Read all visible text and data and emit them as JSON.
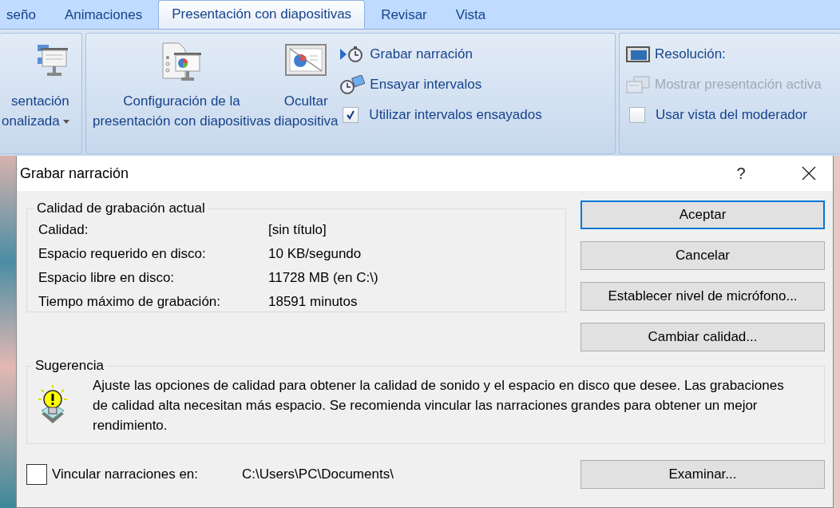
{
  "ribbon": {
    "tabs": [
      {
        "label": "seño",
        "selected": false
      },
      {
        "label": "Animaciones",
        "selected": false
      },
      {
        "label": "Presentación con diapositivas",
        "selected": true
      },
      {
        "label": "Revisar",
        "selected": false
      },
      {
        "label": "Vista",
        "selected": false
      }
    ],
    "custom_show": {
      "label_lines": [
        "sentación",
        "onalizada"
      ],
      "dropdown": true
    },
    "setup_large": [
      {
        "label_lines": [
          "Configuración de la",
          "presentación con diapositivas"
        ]
      },
      {
        "label_lines": [
          "Ocultar",
          "diapositiva"
        ]
      }
    ],
    "setup_commands": [
      {
        "kind": "button",
        "label": "Grabar narración"
      },
      {
        "kind": "button",
        "label": "Ensayar intervalos"
      },
      {
        "kind": "checkbox",
        "label": "Utilizar intervalos ensayados",
        "checked": true
      }
    ],
    "monitor_commands": [
      {
        "kind": "button",
        "label": "Resolución:",
        "disabled": false
      },
      {
        "kind": "button",
        "label": "Mostrar presentación activa",
        "disabled": true
      },
      {
        "kind": "checkbox",
        "label": "Usar vista del moderador",
        "checked": false
      }
    ]
  },
  "dialog": {
    "title": "Grabar narración",
    "help_label": "?",
    "quality_group": {
      "legend": "Calidad de grabación actual",
      "rows": [
        {
          "label": "Calidad:",
          "value": "[sin título]"
        },
        {
          "label": "Espacio requerido en disco:",
          "value": "10 KB/segundo"
        },
        {
          "label": "Espacio libre en disco:",
          "value": "11728 MB (en C:\\)"
        },
        {
          "label": "Tiempo máximo de grabación:",
          "value": "18591 minutos"
        }
      ]
    },
    "buttons": [
      {
        "label": "Aceptar",
        "default": true
      },
      {
        "label": "Cancelar",
        "default": false
      },
      {
        "label": "Establecer nivel de micrófono...",
        "default": false
      },
      {
        "label": "Cambiar calidad...",
        "default": false
      }
    ],
    "tip_group": {
      "legend": "Sugerencia",
      "text": "Ajuste las opciones de calidad para obtener la calidad de sonido y el espacio en disco que desee. Las grabaciones de calidad alta necesitan más espacio. Se recomienda vincular las narraciones grandes para obtener un mejor rendimiento."
    },
    "link": {
      "label": "Vincular narraciones en:",
      "checked": false,
      "path": "C:\\Users\\PC\\Documents\\"
    },
    "browse_button": "Examinar..."
  }
}
